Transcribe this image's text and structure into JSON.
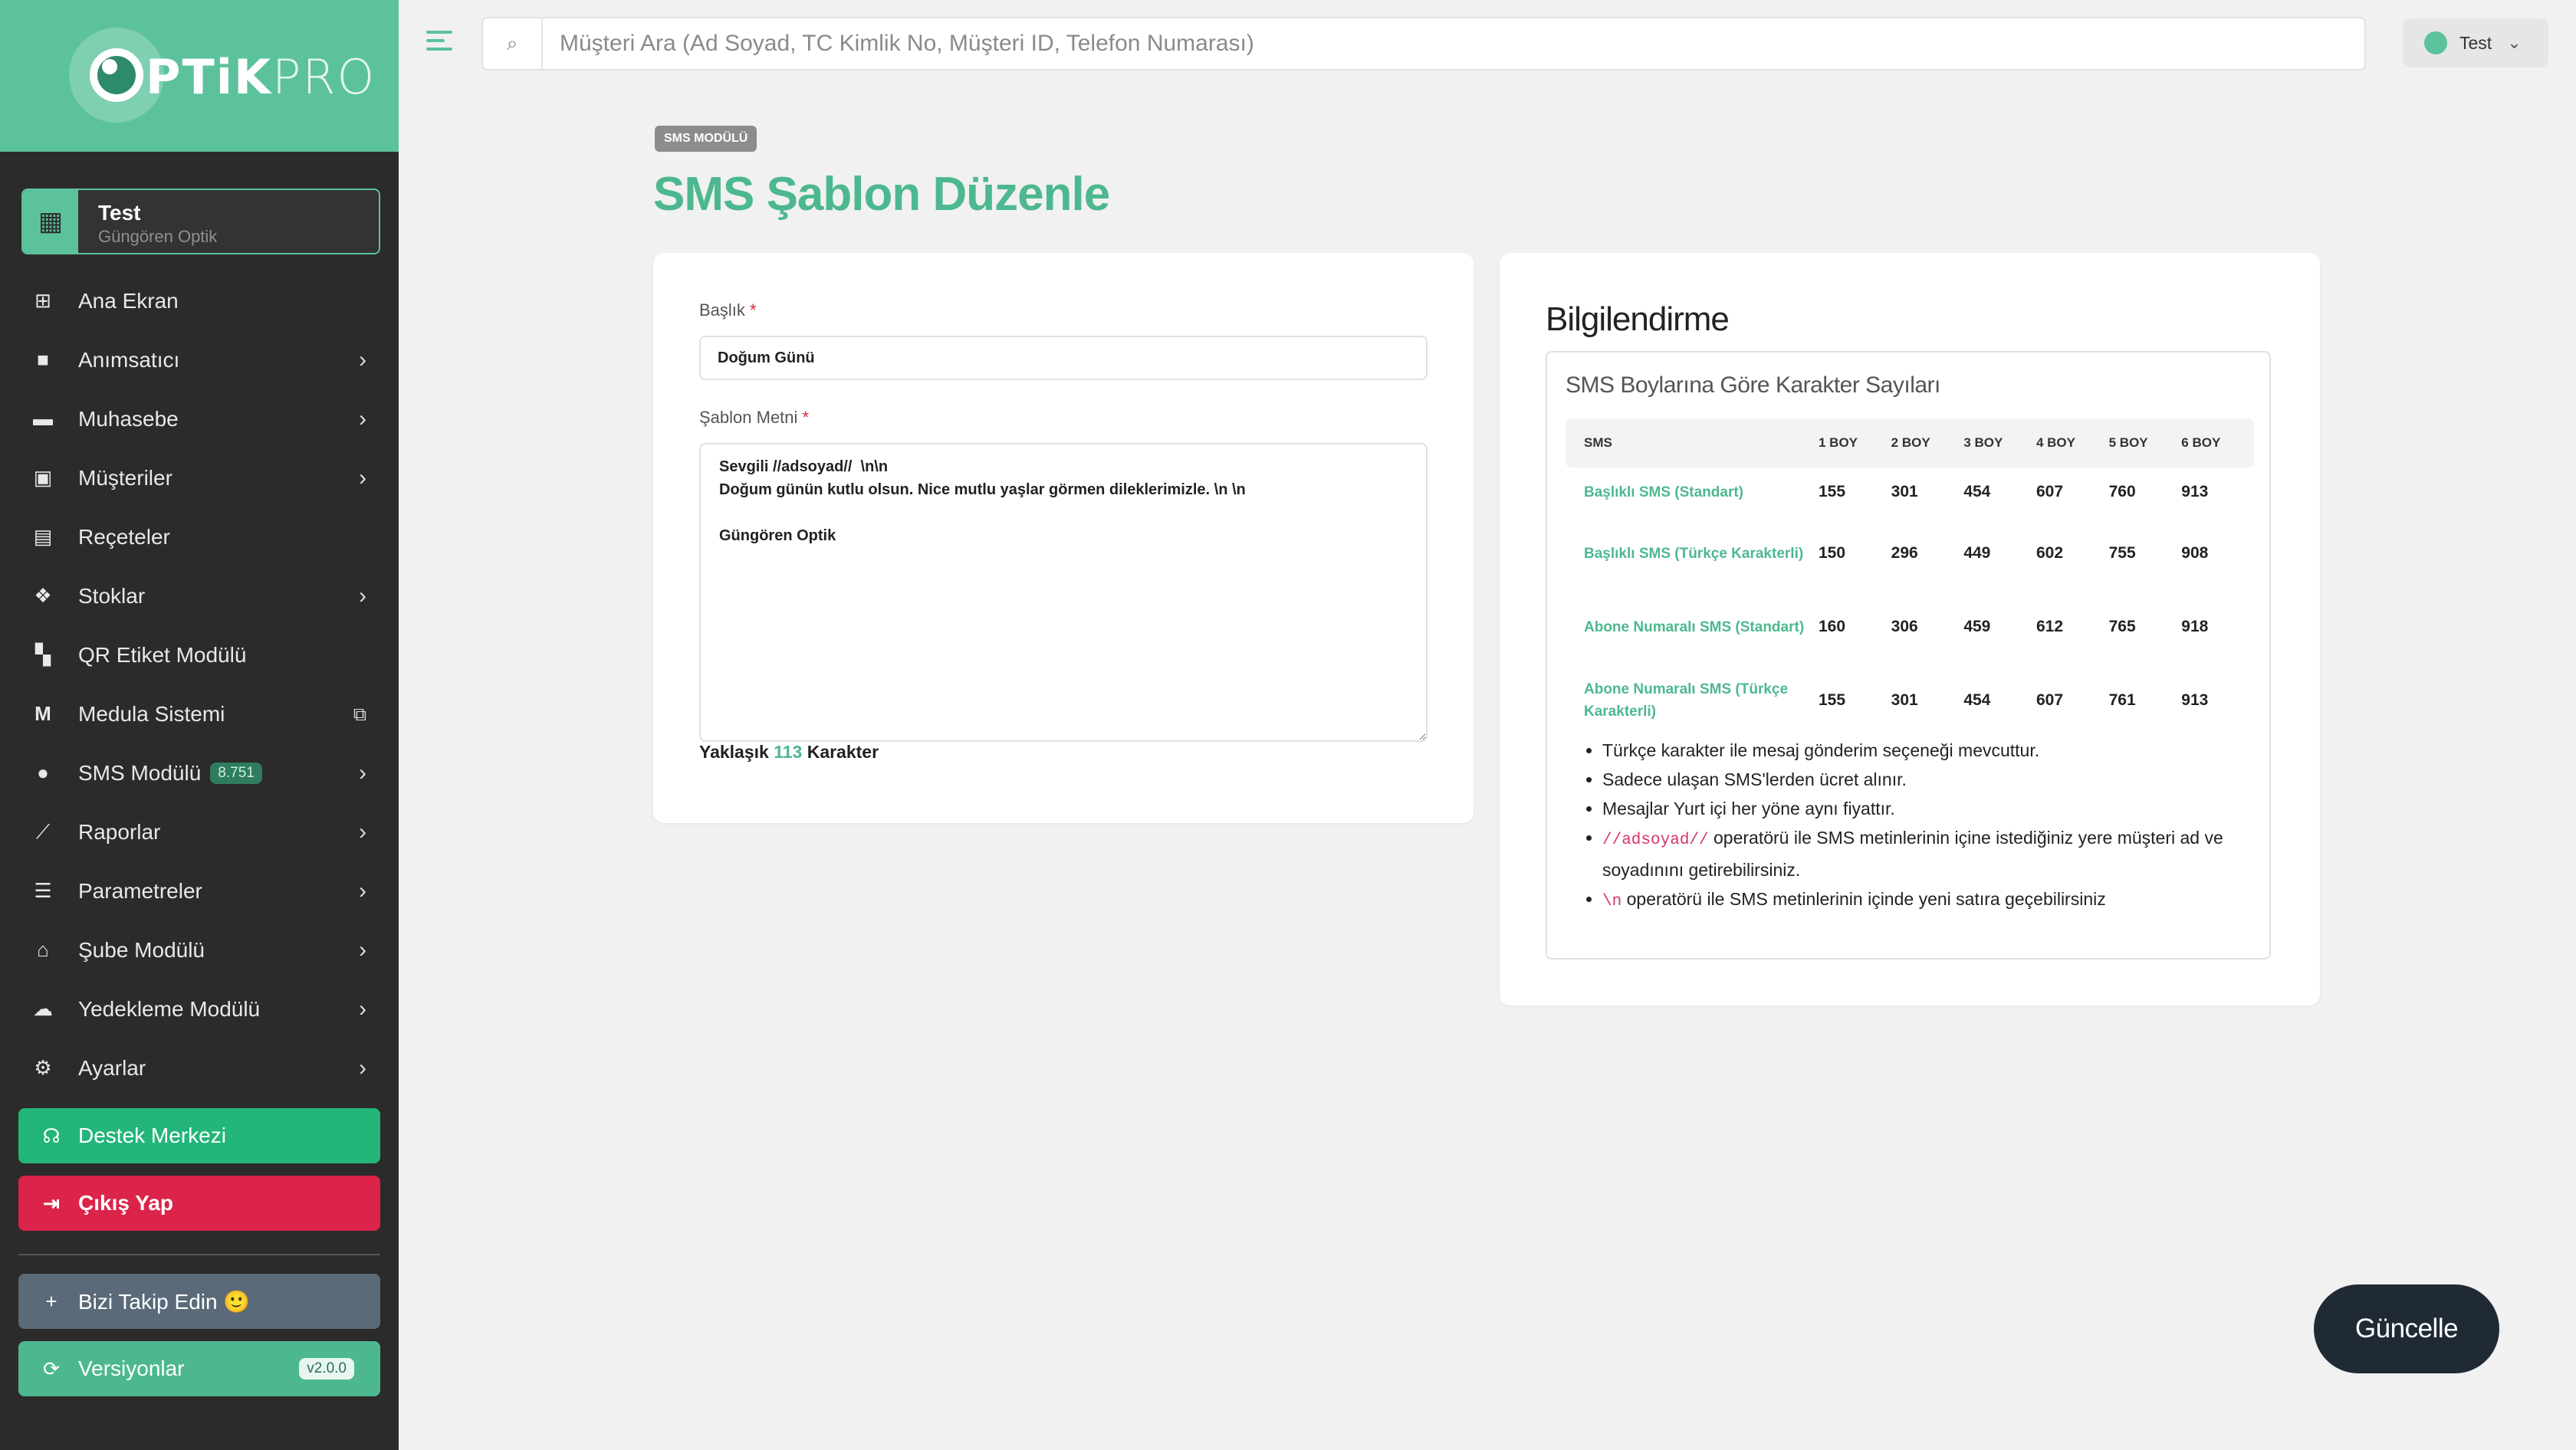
{
  "brand": {
    "logo_bold": "PTiK",
    "logo_light": "PRO",
    "logo_color": "#5cc29c"
  },
  "store": {
    "name": "Test",
    "subtitle": "Güngören Optik"
  },
  "sidebar": {
    "items": [
      {
        "label": "Ana Ekran",
        "icon": "grid-icon"
      },
      {
        "label": "Anımsatıcı",
        "icon": "bookmark-icon"
      },
      {
        "label": "Muhasebe",
        "icon": "wallet-icon"
      },
      {
        "label": "Müşteriler",
        "icon": "address-book-icon"
      },
      {
        "label": "Reçeteler",
        "icon": "file-icon"
      },
      {
        "label": "Stoklar",
        "icon": "cubes-icon"
      },
      {
        "label": "QR Etiket Modülü",
        "icon": "qr-icon"
      },
      {
        "label": "Medula Sistemi",
        "icon": "m-icon"
      },
      {
        "label": "SMS Modülü",
        "icon": "chat-icon",
        "badge": "8.751"
      },
      {
        "label": "Raporlar",
        "icon": "chart-icon"
      },
      {
        "label": "Parametreler",
        "icon": "list-icon"
      },
      {
        "label": "Şube Modülü",
        "icon": "store-icon"
      },
      {
        "label": "Yedekleme Modülü",
        "icon": "cloud-icon"
      },
      {
        "label": "Ayarlar",
        "icon": "gears-icon"
      }
    ],
    "support": "Destek Merkezi",
    "logout": "Çıkış Yap",
    "follow": "Bizi Takip Edin 🙂",
    "versions": "Versiyonlar",
    "version_badge": "v2.0.0"
  },
  "topbar": {
    "search_placeholder": "Müşteri Ara (Ad Soyad, TC Kimlik No, Müşteri ID, Telefon Numarası)",
    "user": "Test"
  },
  "page": {
    "breadcrumb": "SMS MODÜLÜ",
    "title": "SMS Şablon Düzenle"
  },
  "form": {
    "title_label": "Başlık",
    "title_value": "Doğum Günü",
    "body_label": "Şablon Metni",
    "body_value": "Sevgili //adsoyad//  \\n\\n\nDoğum günün kutlu olsun. Nice mutlu yaşlar görmen dileklerimizle. \\n \\n\n\nGüngören Optik",
    "counter_prefix": "Yaklaşık",
    "counter_value": "113",
    "counter_suffix": "Karakter"
  },
  "info": {
    "title": "Bilgilendirme",
    "panel_title": "SMS Boylarına Göre Karakter Sayıları",
    "columns": [
      "SMS",
      "1 BOY",
      "2 BOY",
      "3 BOY",
      "4 BOY",
      "5 BOY",
      "6 BOY"
    ],
    "rows": [
      {
        "name": "Başlıklı SMS (Standart)",
        "values": [
          "155",
          "301",
          "454",
          "607",
          "760",
          "913"
        ]
      },
      {
        "name": "Başlıklı SMS (Türkçe Karakterli)",
        "values": [
          "150",
          "296",
          "449",
          "602",
          "755",
          "908"
        ]
      },
      {
        "name": "Abone Numaralı SMS (Standart)",
        "values": [
          "160",
          "306",
          "459",
          "612",
          "765",
          "918"
        ]
      },
      {
        "name": "Abone Numaralı SMS (Türkçe Karakterli)",
        "values": [
          "155",
          "301",
          "454",
          "607",
          "761",
          "913"
        ]
      }
    ],
    "notes": [
      {
        "code": "",
        "text": "Türkçe karakter ile mesaj gönderim seçeneği mevcuttur."
      },
      {
        "code": "",
        "text": "Sadece ulaşan SMS'lerden ücret alınır."
      },
      {
        "code": "",
        "text": "Mesajlar Yurt içi her yöne aynı fiyattır."
      },
      {
        "code": "//adsoyad//",
        "text": " operatörü ile SMS metinlerinin içine istediğiniz yere müşteri ad ve soyadınını getirebilirsiniz."
      },
      {
        "code": "\\n",
        "text": " operatörü ile SMS metinlerinin içinde yeni satıra geçebilirsiniz"
      }
    ]
  },
  "actions": {
    "update": "Güncelle"
  },
  "colors": {
    "accent": "#5cc29c",
    "support_btn": "#23b57a",
    "logout_btn": "#dc2349",
    "follow_btn": "#5a6a78",
    "versions_btn": "#4db88f",
    "update_btn": "#1f2a35"
  }
}
